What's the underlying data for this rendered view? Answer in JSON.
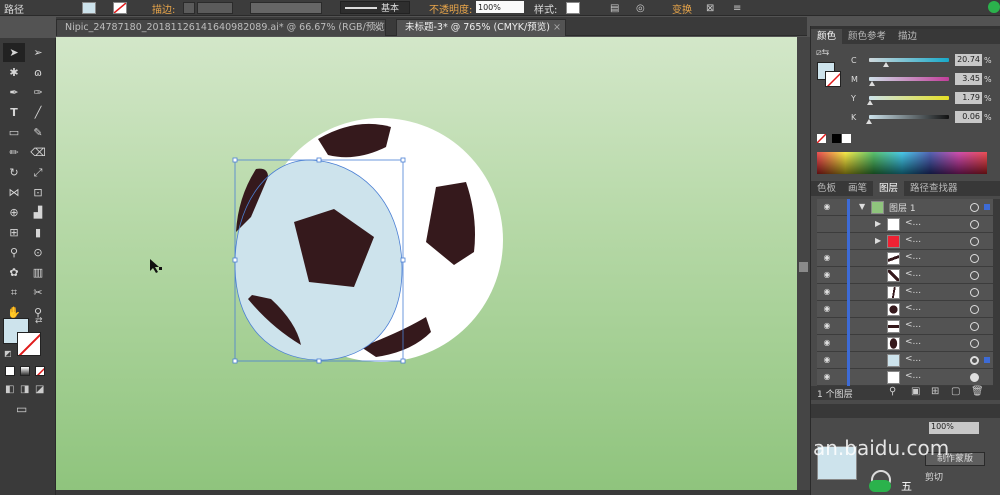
{
  "control_bar": {
    "object_type": "路径",
    "stroke_label": "描边:",
    "stroke_style": "基本",
    "opacity_label": "不透明度:",
    "opacity_value": "100%",
    "style_label": "样式:",
    "transform_label": "变换"
  },
  "tabs": [
    {
      "label": "Nipic_24787180_20181126141640982089.ai* @ 66.67% (RGB/预览)",
      "active": false
    },
    {
      "label": "未标题-3* @ 765% (CMYK/预览)",
      "active": true
    }
  ],
  "toolbox": {
    "fill_color": "#cde3ec",
    "tools": [
      "selection-tool",
      "direct-selection-tool",
      "magic-wand-tool",
      "lasso-tool",
      "pen-tool",
      "curvature-tool",
      "type-tool",
      "line-tool",
      "rectangle-tool",
      "paintbrush-tool",
      "pencil-tool",
      "eraser-tool",
      "rotate-tool",
      "scale-tool",
      "width-tool",
      "free-transform-tool",
      "shape-builder-tool",
      "perspective-grid-tool",
      "mesh-tool",
      "gradient-tool",
      "eyedropper-tool",
      "blend-tool",
      "symbol-sprayer-tool",
      "column-graph-tool",
      "artboard-tool",
      "slice-tool",
      "hand-tool",
      "zoom-tool"
    ]
  },
  "canvas": {
    "ball_black": "#35191c",
    "ball_white": "#ffffff",
    "selected_fill": "#cde3ec",
    "selection_color": "#4a7fd4"
  },
  "color_panel": {
    "tabs": [
      "颜色",
      "颜色参考",
      "描边"
    ],
    "cmyk": [
      {
        "label": "C",
        "value": "20.74",
        "fraction": 0.2074
      },
      {
        "label": "M",
        "value": "3.45",
        "fraction": 0.0345
      },
      {
        "label": "Y",
        "value": "1.79",
        "fraction": 0.0179
      },
      {
        "label": "K",
        "value": "0.06",
        "fraction": 0.0006
      }
    ],
    "percent": "%"
  },
  "layers_panel": {
    "tabs": [
      "色板",
      "画笔",
      "图层",
      "路径查找器"
    ],
    "layer_name": "图层 1",
    "layer_color": "#3d6bd6",
    "sublayer_name": "<...",
    "rows": 12,
    "footer_label": "1 个图层"
  },
  "watermark": {
    "text": "an.baidu.com",
    "brand": "五"
  },
  "bottom_panel": {
    "mask_label": "制作蒙版",
    "clip_label": "剪切",
    "opacity_value": "100%"
  }
}
